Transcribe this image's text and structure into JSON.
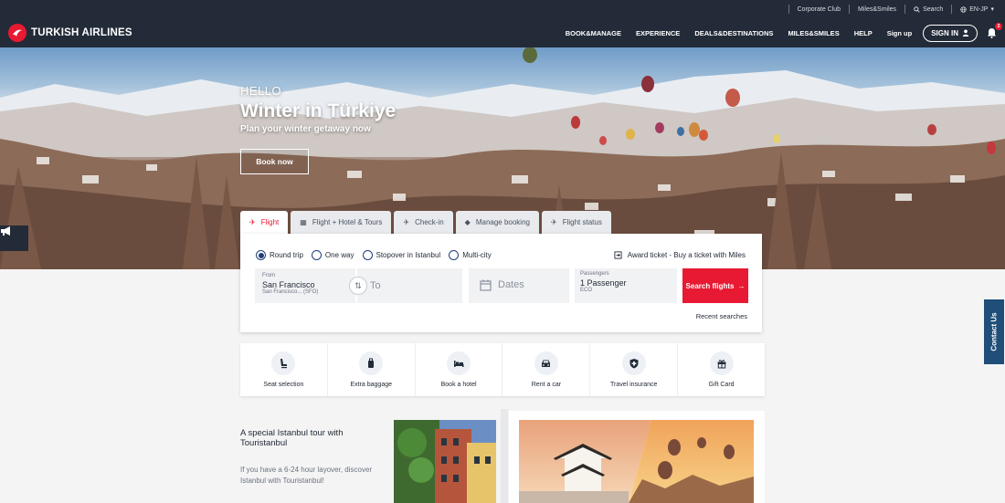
{
  "utility_bar": {
    "corporate_club": "Corporate Club",
    "miles_smiles": "Miles&Smiles",
    "search": "Search",
    "language": "EN-JP"
  },
  "header": {
    "brand": "TURKISH AIRLINES",
    "nav": [
      "BOOK&MANAGE",
      "EXPERIENCE",
      "DEALS&DESTINATIONS",
      "MILES&SMILES",
      "HELP",
      "Sign up"
    ],
    "sign_in": "SIGN IN",
    "notification_count": "2"
  },
  "hero": {
    "greeting": "HELLO",
    "headline": "Winter in Türkiye",
    "subline": "Plan your winter getaway now",
    "cta": "Book now"
  },
  "booking": {
    "tabs": [
      "Flight",
      "Flight + Hotel & Tours",
      "Check-in",
      "Manage booking",
      "Flight status"
    ],
    "trip_types": [
      "Round trip",
      "One way",
      "Stopover in Istanbul",
      "Multi-city"
    ],
    "award_link": "Award ticket - Buy a ticket with Miles",
    "from_label": "From",
    "from_city": "San Francisco",
    "from_detail": "San Francisco... (SFO)",
    "to_placeholder": "To",
    "dates_placeholder": "Dates",
    "passengers_label": "Passengers",
    "passengers_value": "1 Passenger",
    "cabin": "ECO",
    "search_button": "Search flights",
    "recent_searches": "Recent searches"
  },
  "services": [
    {
      "label": "Seat selection",
      "icon": "seat-icon"
    },
    {
      "label": "Extra baggage",
      "icon": "baggage-icon"
    },
    {
      "label": "Book a hotel",
      "icon": "bed-icon"
    },
    {
      "label": "Rent a car",
      "icon": "car-icon"
    },
    {
      "label": "Travel insurance",
      "icon": "shield-icon"
    },
    {
      "label": "Gift Card",
      "icon": "gift-icon"
    }
  ],
  "promo": {
    "title": "A special Istanbul tour with Touristanbul",
    "description": "If you have a 6-24 hour layover, discover Istanbul with Touristanbul!"
  },
  "contact_tab": "Contact Us",
  "colors": {
    "brand_red": "#e81932",
    "header_navy": "#232b38",
    "radio_blue": "#1f3f7a",
    "contact_blue": "#1f4e79"
  }
}
